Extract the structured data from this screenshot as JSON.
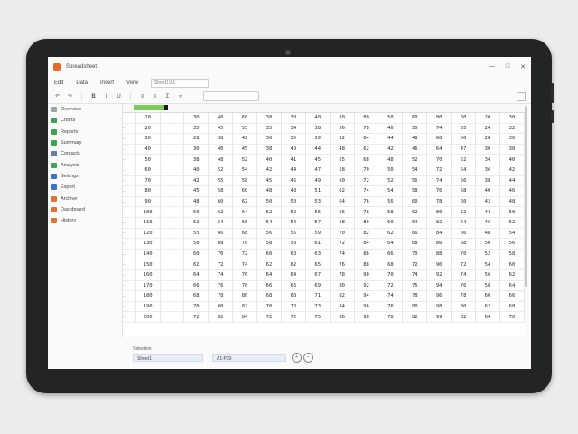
{
  "window": {
    "title": "Spreadsheet",
    "controls": [
      "—",
      "□",
      "✕"
    ]
  },
  "menu": [
    "Edit",
    "Data",
    "Insert",
    "View"
  ],
  "name_box": "Sheet1!A1",
  "sidebar": {
    "items": [
      {
        "label": "Overview",
        "color": "#9aa4ad"
      },
      {
        "label": "Charts",
        "color": "#3aa655"
      },
      {
        "label": "Reports",
        "color": "#3aa655"
      },
      {
        "label": "Summary",
        "color": "#3aa655"
      },
      {
        "label": "Contacts",
        "color": "#5f7da8"
      },
      {
        "label": "Analysis",
        "color": "#3aa655"
      },
      {
        "label": "Settings",
        "color": "#3b73c7"
      },
      {
        "label": "Export",
        "color": "#3b73c7"
      },
      {
        "label": "Archive",
        "color": "#e27430"
      },
      {
        "label": "Dashboard",
        "color": "#e27430"
      },
      {
        "label": "History",
        "color": "#e27430"
      }
    ]
  },
  "grid": {
    "headers": [
      "",
      "",
      "",
      "",
      "",
      "",
      "",
      "",
      "",
      "",
      "",
      "",
      "",
      "",
      "",
      ""
    ],
    "rows": [
      [
        "10",
        "",
        "30",
        "40",
        "60",
        "38",
        "30",
        "40",
        "60",
        "80",
        "50",
        "60",
        "80",
        "60",
        "20",
        "30"
      ],
      [
        "20",
        "",
        "35",
        "45",
        "55",
        "35",
        "34",
        "38",
        "56",
        "78",
        "46",
        "55",
        "74",
        "55",
        "24",
        "32"
      ],
      [
        "30",
        "",
        "28",
        "38",
        "42",
        "30",
        "35",
        "39",
        "52",
        "64",
        "44",
        "48",
        "68",
        "50",
        "28",
        "36"
      ],
      [
        "40",
        "",
        "30",
        "40",
        "45",
        "38",
        "40",
        "44",
        "48",
        "62",
        "42",
        "46",
        "64",
        "47",
        "30",
        "38"
      ],
      [
        "50",
        "",
        "38",
        "48",
        "52",
        "40",
        "41",
        "45",
        "55",
        "68",
        "48",
        "52",
        "70",
        "52",
        "34",
        "40"
      ],
      [
        "60",
        "",
        "40",
        "52",
        "54",
        "42",
        "44",
        "47",
        "58",
        "70",
        "50",
        "54",
        "72",
        "54",
        "36",
        "42"
      ],
      [
        "70",
        "",
        "42",
        "55",
        "58",
        "45",
        "46",
        "49",
        "60",
        "72",
        "52",
        "56",
        "74",
        "56",
        "38",
        "44"
      ],
      [
        "80",
        "",
        "45",
        "58",
        "60",
        "48",
        "48",
        "51",
        "62",
        "74",
        "54",
        "58",
        "76",
        "58",
        "40",
        "46"
      ],
      [
        "90",
        "",
        "48",
        "60",
        "62",
        "50",
        "50",
        "53",
        "64",
        "76",
        "56",
        "60",
        "78",
        "60",
        "42",
        "48"
      ],
      [
        "100",
        "",
        "50",
        "62",
        "64",
        "52",
        "52",
        "55",
        "66",
        "78",
        "58",
        "62",
        "80",
        "62",
        "44",
        "50"
      ],
      [
        "110",
        "",
        "52",
        "64",
        "66",
        "54",
        "54",
        "57",
        "68",
        "80",
        "60",
        "64",
        "82",
        "64",
        "46",
        "52"
      ],
      [
        "120",
        "",
        "55",
        "66",
        "68",
        "56",
        "56",
        "59",
        "70",
        "82",
        "62",
        "66",
        "84",
        "66",
        "48",
        "54"
      ],
      [
        "130",
        "",
        "58",
        "68",
        "70",
        "58",
        "58",
        "61",
        "72",
        "84",
        "64",
        "68",
        "86",
        "68",
        "50",
        "56"
      ],
      [
        "140",
        "",
        "60",
        "70",
        "72",
        "60",
        "60",
        "63",
        "74",
        "86",
        "66",
        "70",
        "88",
        "70",
        "52",
        "58"
      ],
      [
        "150",
        "",
        "62",
        "72",
        "74",
        "62",
        "62",
        "65",
        "76",
        "88",
        "68",
        "72",
        "90",
        "72",
        "54",
        "60"
      ],
      [
        "160",
        "",
        "64",
        "74",
        "76",
        "64",
        "64",
        "67",
        "78",
        "90",
        "70",
        "74",
        "92",
        "74",
        "56",
        "62"
      ],
      [
        "170",
        "",
        "66",
        "76",
        "78",
        "66",
        "66",
        "69",
        "80",
        "92",
        "72",
        "76",
        "94",
        "76",
        "58",
        "64"
      ],
      [
        "180",
        "",
        "68",
        "78",
        "80",
        "68",
        "68",
        "71",
        "82",
        "94",
        "74",
        "78",
        "96",
        "78",
        "60",
        "66"
      ],
      [
        "190",
        "",
        "70",
        "80",
        "82",
        "70",
        "70",
        "73",
        "84",
        "96",
        "76",
        "80",
        "98",
        "80",
        "62",
        "68"
      ],
      [
        "200",
        "",
        "72",
        "82",
        "84",
        "72",
        "72",
        "75",
        "86",
        "98",
        "78",
        "82",
        "99",
        "82",
        "64",
        "70"
      ]
    ]
  },
  "status": {
    "label": "Selection",
    "field1": "Sheet1",
    "field2": "A1:P20"
  }
}
